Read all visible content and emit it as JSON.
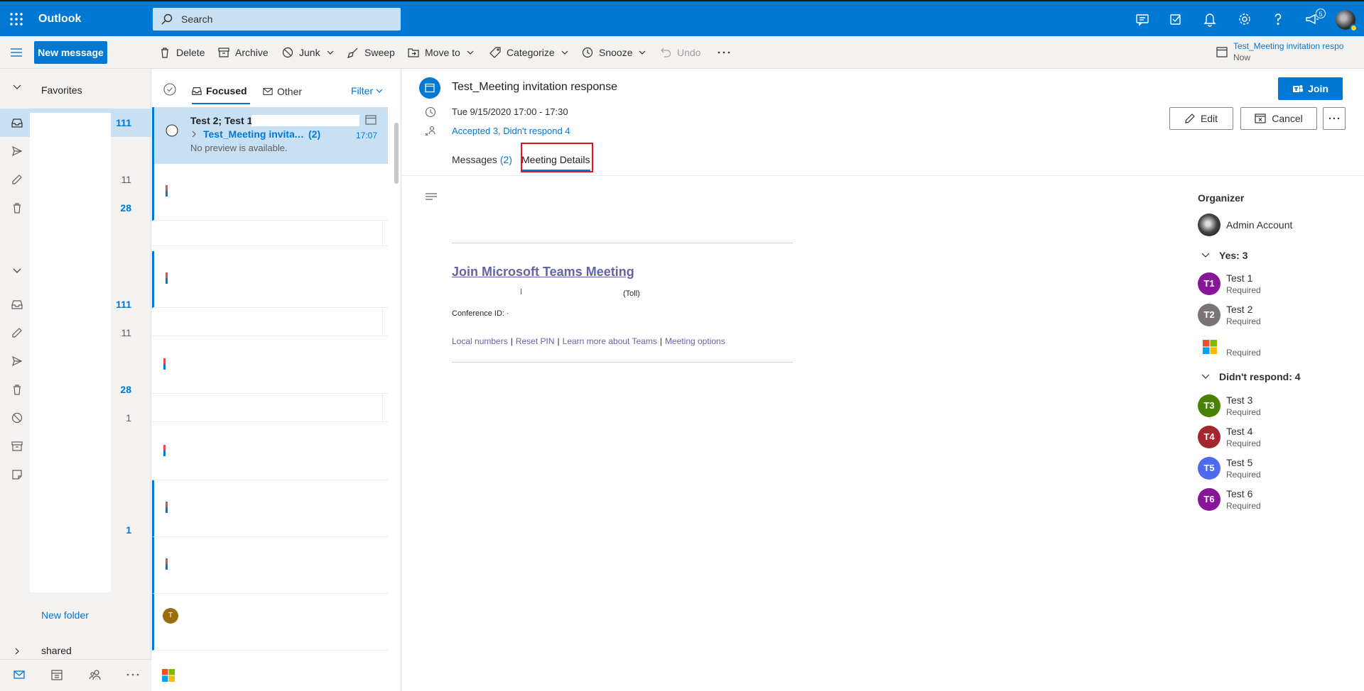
{
  "app": {
    "name": "Outlook"
  },
  "search": {
    "placeholder": "Search"
  },
  "topbar": {
    "notification_count": "5"
  },
  "commands": {
    "new_message": "New message",
    "delete": "Delete",
    "archive": "Archive",
    "junk": "Junk",
    "sweep": "Sweep",
    "move_to": "Move to",
    "categorize": "Categorize",
    "snooze": "Snooze",
    "undo": "Undo"
  },
  "reminder": {
    "title": "Test_Meeting invitation respo",
    "time": "Now"
  },
  "nav": {
    "favorites_label": "Favorites",
    "favorites": [
      {
        "icon": "inbox-icon",
        "count": "111",
        "bold": true
      },
      {
        "icon": "send-icon",
        "count": ""
      },
      {
        "icon": "pencil-icon",
        "count": "11",
        "bold": false
      },
      {
        "icon": "trash-icon",
        "count": "28",
        "bold": true
      }
    ],
    "folders": [
      {
        "icon": "inbox-icon",
        "count": "111",
        "bold": true
      },
      {
        "icon": "pencil-icon",
        "count": "11",
        "bold": false
      },
      {
        "icon": "send-icon",
        "count": ""
      },
      {
        "icon": "trash-icon",
        "count": "28",
        "bold": true
      },
      {
        "icon": "block-icon",
        "count": "1",
        "bold": false
      },
      {
        "icon": "archive-icon",
        "count": ""
      },
      {
        "icon": "note-icon",
        "count": ""
      }
    ],
    "extra_count": "1",
    "new_folder": "New folder",
    "shared": "shared"
  },
  "list": {
    "tab_focused": "Focused",
    "tab_other": "Other",
    "filter": "Filter",
    "selected_message": {
      "from": "Test 2; Test 1;",
      "subject": "Test_Meeting invitation response",
      "thread_count": "(2)",
      "time": "17:07",
      "preview": "No preview is available."
    },
    "avatar_initial": "T"
  },
  "event": {
    "title": "Test_Meeting invitation response",
    "time": "Tue 9/15/2020 17:00 - 17:30",
    "attendance": "Accepted 3, Didn't respond 4",
    "join": "Join",
    "edit": "Edit",
    "cancel": "Cancel",
    "tab_messages": "Messages",
    "tab_messages_count": "(2)",
    "tab_details": "Meeting Details"
  },
  "teams": {
    "link": "Join Microsoft Teams Meeting",
    "toll": "(Toll)",
    "conference_id": "Conference ID: ·",
    "links": [
      "Local numbers",
      "Reset PIN",
      "Learn more about Teams",
      "Meeting options"
    ]
  },
  "attendees": {
    "organizer_label": "Organizer",
    "organizer": {
      "name": "Admin Account"
    },
    "yes_label": "Yes: 3",
    "yes": [
      {
        "initials": "T1",
        "name": "Test 1",
        "role": "Required",
        "color": "#881798"
      },
      {
        "initials": "T2",
        "name": "Test 2",
        "role": "Required",
        "color": "#7a7574"
      },
      {
        "initials": "",
        "name": "",
        "role": "Required",
        "color": ""
      }
    ],
    "no_response_label": "Didn't respond: 4",
    "no_response": [
      {
        "initials": "T3",
        "name": "Test 3",
        "role": "Required",
        "color": "#498205"
      },
      {
        "initials": "T4",
        "name": "Test 4",
        "role": "Required",
        "color": "#a4262c"
      },
      {
        "initials": "T5",
        "name": "Test 5",
        "role": "Required",
        "color": "#4f6bed"
      },
      {
        "initials": "T6",
        "name": "Test 6",
        "role": "Required",
        "color": "#881798"
      }
    ]
  },
  "colors": {
    "accent": "#0078d4",
    "selected": "#c7e0f4",
    "teams": "#6264a7",
    "highlight": "#e81123"
  }
}
